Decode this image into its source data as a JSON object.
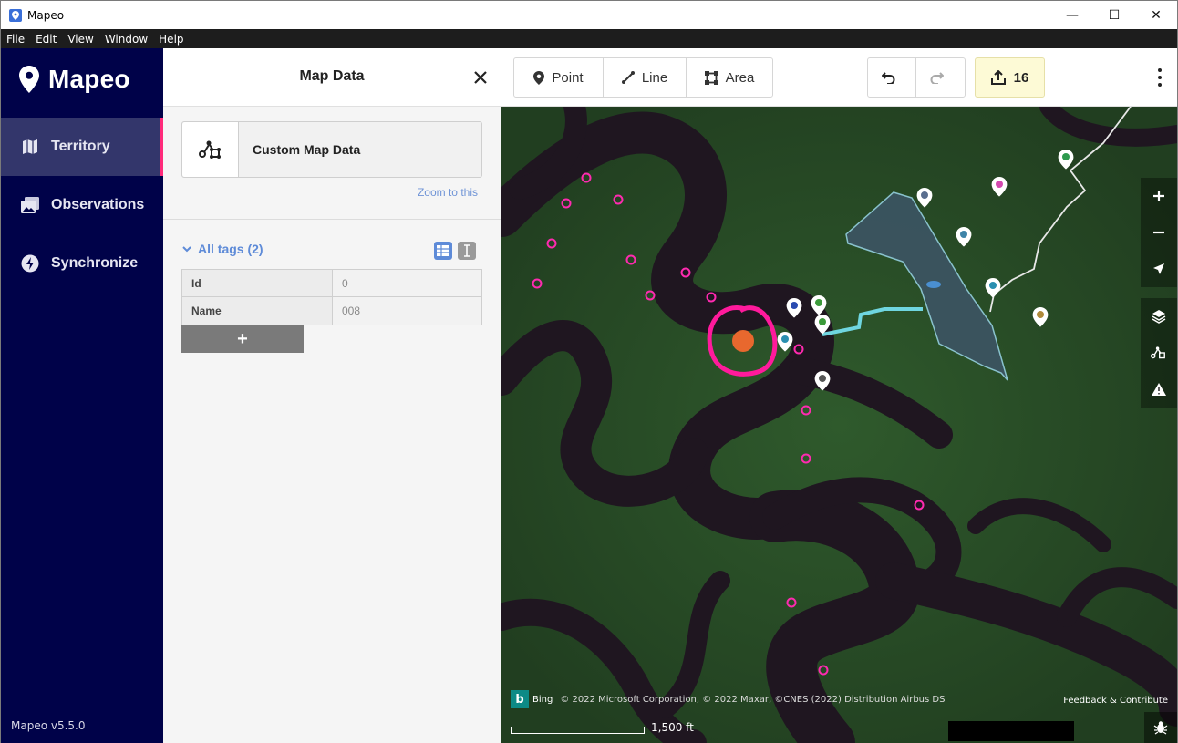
{
  "window": {
    "title": "Mapeo",
    "controls": {
      "minimize": "—",
      "maximize": "☐",
      "close": "✕"
    }
  },
  "menu": [
    "File",
    "Edit",
    "View",
    "Window",
    "Help"
  ],
  "sidebar": {
    "logo": "Mapeo",
    "items": [
      {
        "label": "Territory",
        "icon": "map-icon",
        "active": true
      },
      {
        "label": "Observations",
        "icon": "photo-icon",
        "active": false
      },
      {
        "label": "Synchronize",
        "icon": "sync-bolt-icon",
        "active": false
      }
    ],
    "version": "Mapeo v5.5.0",
    "accent": "#ff2a7a",
    "background": "#000249"
  },
  "panel": {
    "title": "Map Data",
    "card_label": "Custom Map Data",
    "zoom_link": "Zoom to this",
    "tags_header": "All tags (2)",
    "tags": [
      {
        "key": "Id",
        "value": "0"
      },
      {
        "key": "Name",
        "value": "008"
      }
    ],
    "add_button": "+"
  },
  "toolbar": {
    "point": "Point",
    "line": "Line",
    "area": "Area",
    "upload_count": "16",
    "upload_bg": "#fdfad6"
  },
  "map": {
    "attribution": "© 2022 Microsoft Corporation, © 2022 Maxar, ©CNES (2022) Distribution Airbus DS",
    "bing": "Bing",
    "bing_logo": "b",
    "feedback": "Feedback & Contribute",
    "scale_label": "1,500 ft",
    "controls": [
      "zoom-in-icon",
      "zoom-out-icon",
      "locate-icon",
      "layers-icon",
      "custom-data-icon",
      "warning-icon"
    ]
  }
}
